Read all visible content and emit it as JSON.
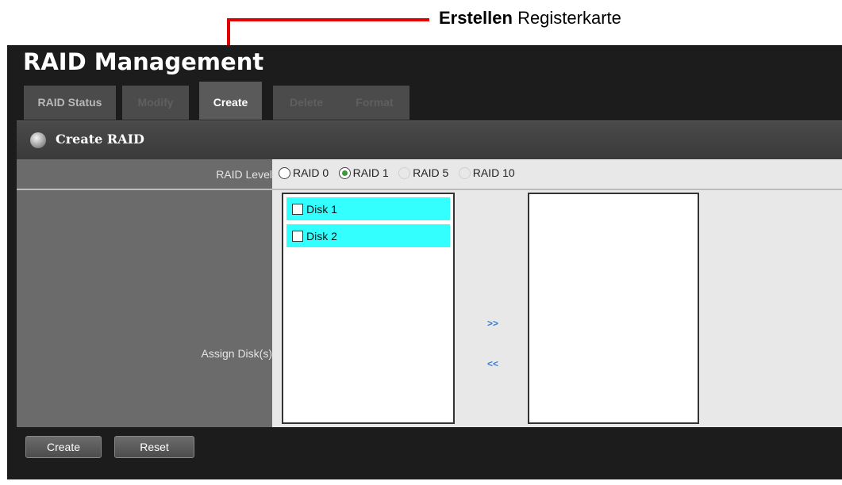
{
  "callout": {
    "bold": "Erstellen",
    "text": "Registerkarte",
    "line_color": "#e10000"
  },
  "app": {
    "title": "RAID Management"
  },
  "tabs": [
    {
      "label": "RAID Status",
      "state": "inactive"
    },
    {
      "label": "Modify",
      "state": "disabled"
    },
    {
      "label": "Create",
      "state": "active"
    },
    {
      "label": "Delete",
      "state": "disabled"
    },
    {
      "label": "Format",
      "state": "disabled"
    }
  ],
  "section": {
    "title": "Create RAID",
    "icon": "disc-icon"
  },
  "form": {
    "raid_level_label": "RAID Level",
    "raid_levels": [
      {
        "label": "RAID 0",
        "checked": false,
        "enabled": true
      },
      {
        "label": "RAID 1",
        "checked": true,
        "enabled": true
      },
      {
        "label": "RAID 5",
        "checked": false,
        "enabled": false
      },
      {
        "label": "RAID 10",
        "checked": false,
        "enabled": false
      }
    ],
    "assign_label": "Assign Disk(s)",
    "available_disks": [
      "Disk 1",
      "Disk 2"
    ],
    "assigned_disks": [],
    "add_arrow": ">>",
    "remove_arrow": "<<"
  },
  "buttons": {
    "create": "Create",
    "reset": "Reset"
  },
  "colors": {
    "disk_highlight": "#33ffff",
    "arrow_link": "#3a7fd0",
    "radio_checked": "#3a9a3a"
  }
}
